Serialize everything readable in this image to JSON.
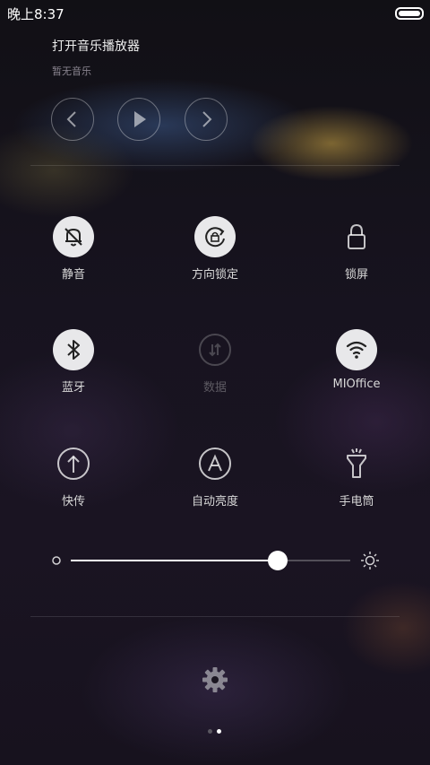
{
  "status_bar": {
    "time": "晚上8:37",
    "battery_icon": "battery-full-icon"
  },
  "music": {
    "title": "打开音乐播放器",
    "subtitle": "暂无音乐",
    "buttons": {
      "prev": "chevron-left-icon",
      "play": "play-icon",
      "next": "chevron-right-icon"
    }
  },
  "tiles": [
    {
      "label": "静音",
      "icon": "bell-off-icon",
      "active": true
    },
    {
      "label": "方向锁定",
      "icon": "rotation-lock-icon",
      "active": true
    },
    {
      "label": "锁屏",
      "icon": "lock-icon",
      "active": false
    },
    {
      "label": "蓝牙",
      "icon": "bluetooth-icon",
      "active": true
    },
    {
      "label": "数据",
      "icon": "mobile-data-icon",
      "active": false,
      "disabled": true
    },
    {
      "label": "MIOffice",
      "icon": "wifi-icon",
      "active": true
    },
    {
      "label": "快传",
      "icon": "upload-icon",
      "active": false
    },
    {
      "label": "自动亮度",
      "icon": "auto-brightness-icon",
      "active": false
    },
    {
      "label": "手电筒",
      "icon": "flashlight-icon",
      "active": false
    }
  ],
  "brightness": {
    "value": 0.74,
    "low_icon": "brightness-low-icon",
    "high_icon": "brightness-high-icon"
  },
  "settings_icon": "gear-icon",
  "pager": {
    "pages": 2,
    "current": 2
  },
  "colors": {
    "active_icon_bg": "#e8e8ea",
    "text": "#ffffff",
    "dim_text": "#5d5a62"
  }
}
